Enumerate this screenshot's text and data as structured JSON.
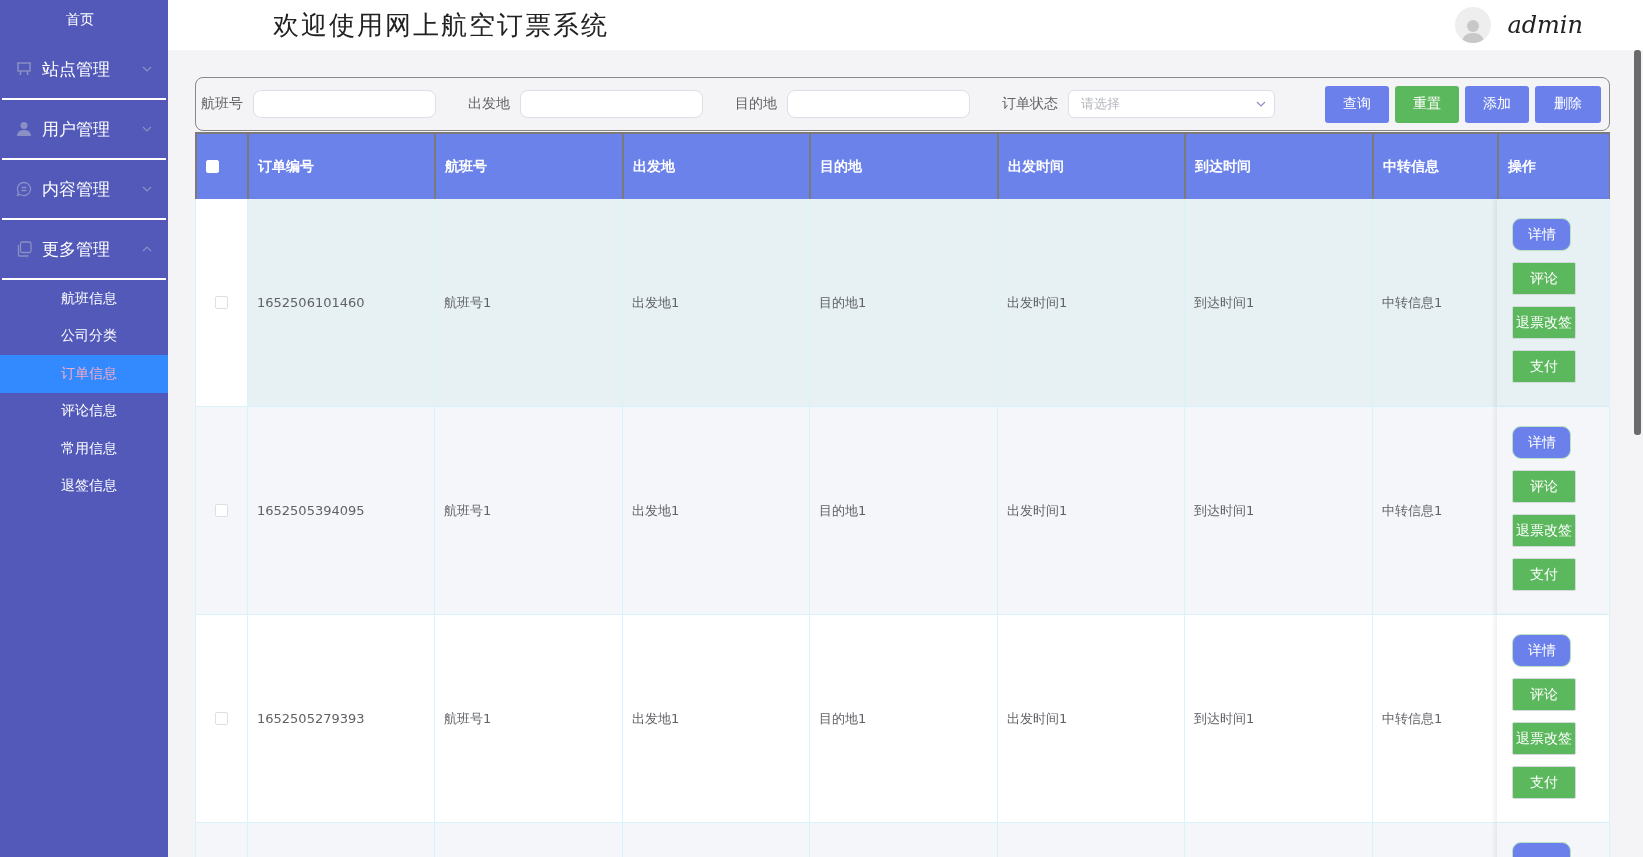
{
  "sidebar": {
    "home": "首页",
    "groups": [
      {
        "label": "站点管理",
        "expanded": false
      },
      {
        "label": "用户管理",
        "expanded": false
      },
      {
        "label": "内容管理",
        "expanded": false
      },
      {
        "label": "更多管理",
        "expanded": true,
        "items": [
          {
            "label": "航班信息",
            "selected": false
          },
          {
            "label": "公司分类",
            "selected": false
          },
          {
            "label": "订单信息",
            "selected": true
          },
          {
            "label": "评论信息",
            "selected": false
          },
          {
            "label": "常用信息",
            "selected": false
          },
          {
            "label": "退签信息",
            "selected": false
          }
        ]
      }
    ]
  },
  "header": {
    "title": "欢迎使用网上航空订票系统",
    "user": "admin"
  },
  "search": {
    "filters": [
      {
        "kind": "input",
        "label": "航班号"
      },
      {
        "kind": "input",
        "label": "出发地"
      },
      {
        "kind": "input",
        "label": "目的地"
      },
      {
        "kind": "select",
        "label": "订单状态",
        "placeholder": "请选择"
      }
    ],
    "buttons": [
      {
        "label": "查询",
        "kind": "primary"
      },
      {
        "label": "重置",
        "kind": "success"
      },
      {
        "label": "添加",
        "kind": "primary"
      },
      {
        "label": "删除",
        "kind": "primary"
      }
    ]
  },
  "table": {
    "all_checked": false,
    "columns": [
      "订单编号",
      "航班号",
      "出发地",
      "目的地",
      "出发时间",
      "到达时间",
      "中转信息",
      "操作"
    ],
    "rows": [
      {
        "checked": false,
        "highlighted": true,
        "cells": [
          "1652506101460",
          "航班号1",
          "出发地1",
          "目的地1",
          "出发时间1",
          "到达时间1",
          "中转信息1"
        ],
        "actions": [
          {
            "label": "详情",
            "kind": "detail"
          },
          {
            "label": "评论",
            "kind": "success"
          },
          {
            "label": "退票改签",
            "kind": "success"
          },
          {
            "label": "支付",
            "kind": "success"
          }
        ]
      },
      {
        "checked": false,
        "highlighted": false,
        "cells": [
          "1652505394095",
          "航班号1",
          "出发地1",
          "目的地1",
          "出发时间1",
          "到达时间1",
          "中转信息1"
        ],
        "actions": [
          {
            "label": "详情",
            "kind": "detail"
          },
          {
            "label": "评论",
            "kind": "success"
          },
          {
            "label": "退票改签",
            "kind": "success"
          },
          {
            "label": "支付",
            "kind": "success"
          }
        ]
      },
      {
        "checked": false,
        "highlighted": false,
        "cells": [
          "1652505279393",
          "航班号1",
          "出发地1",
          "目的地1",
          "出发时间1",
          "到达时间1",
          "中转信息1"
        ],
        "actions": [
          {
            "label": "详情",
            "kind": "detail"
          },
          {
            "label": "评论",
            "kind": "success"
          },
          {
            "label": "退票改签",
            "kind": "success"
          },
          {
            "label": "支付",
            "kind": "success"
          }
        ]
      },
      {
        "actions": [
          {
            "kind": "detail"
          }
        ]
      }
    ]
  }
}
